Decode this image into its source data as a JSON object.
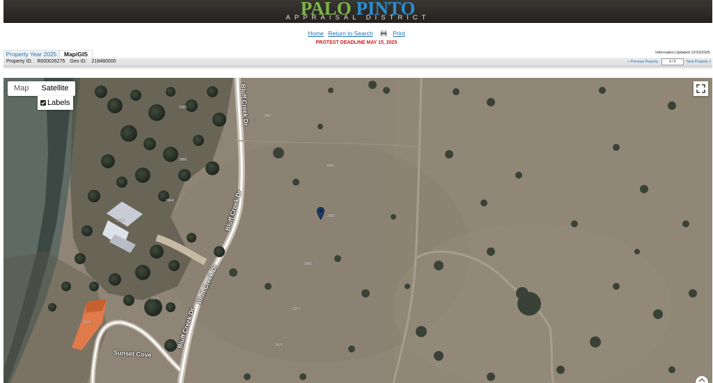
{
  "header": {
    "logo_word1": "PALO",
    "logo_word2": "PINTO",
    "logo_sub": "APPRAISAL DISTRICT"
  },
  "nav": {
    "home": "Home",
    "return": "Return to Search",
    "print": "Print",
    "print_icon": "printer-icon"
  },
  "deadline": "PROTEST DEADLINE MAY 15, 2025",
  "tabs": {
    "property_year": "Property Year 2025",
    "map_gis": "Map/GIS"
  },
  "updated": "Information Updated 12/23/2025",
  "property": {
    "id_label": "Property ID:",
    "id_value": "R000026275",
    "geo_label": "Geo ID:",
    "geo_value": "218480000"
  },
  "pager": {
    "prev": "< Previous Property",
    "position": "3 / 5",
    "next": "Next Property >"
  },
  "map": {
    "map_button": "Map",
    "satellite_button": "Satellite",
    "labels_toggle": "Labels",
    "labels_checked": true,
    "fullscreen_icon": "fullscreen-icon",
    "roads": [
      "Bluff Creek Dr",
      "Bluff Creek Dr",
      "Bluff Creek Dr",
      "Bluff Creek Dr",
      "Sunset Cove"
    ],
    "address_numbers": [
      "2055",
      "2067",
      "2060",
      "2061",
      "2064",
      "2068",
      "2065",
      "2060",
      "2072",
      "2073",
      "2076",
      "2071"
    ]
  },
  "colors": {
    "logo_green": "#7ab648",
    "logo_blue": "#2a8fd0",
    "link": "#1a6fb3",
    "deadline_red": "#d0181c"
  }
}
